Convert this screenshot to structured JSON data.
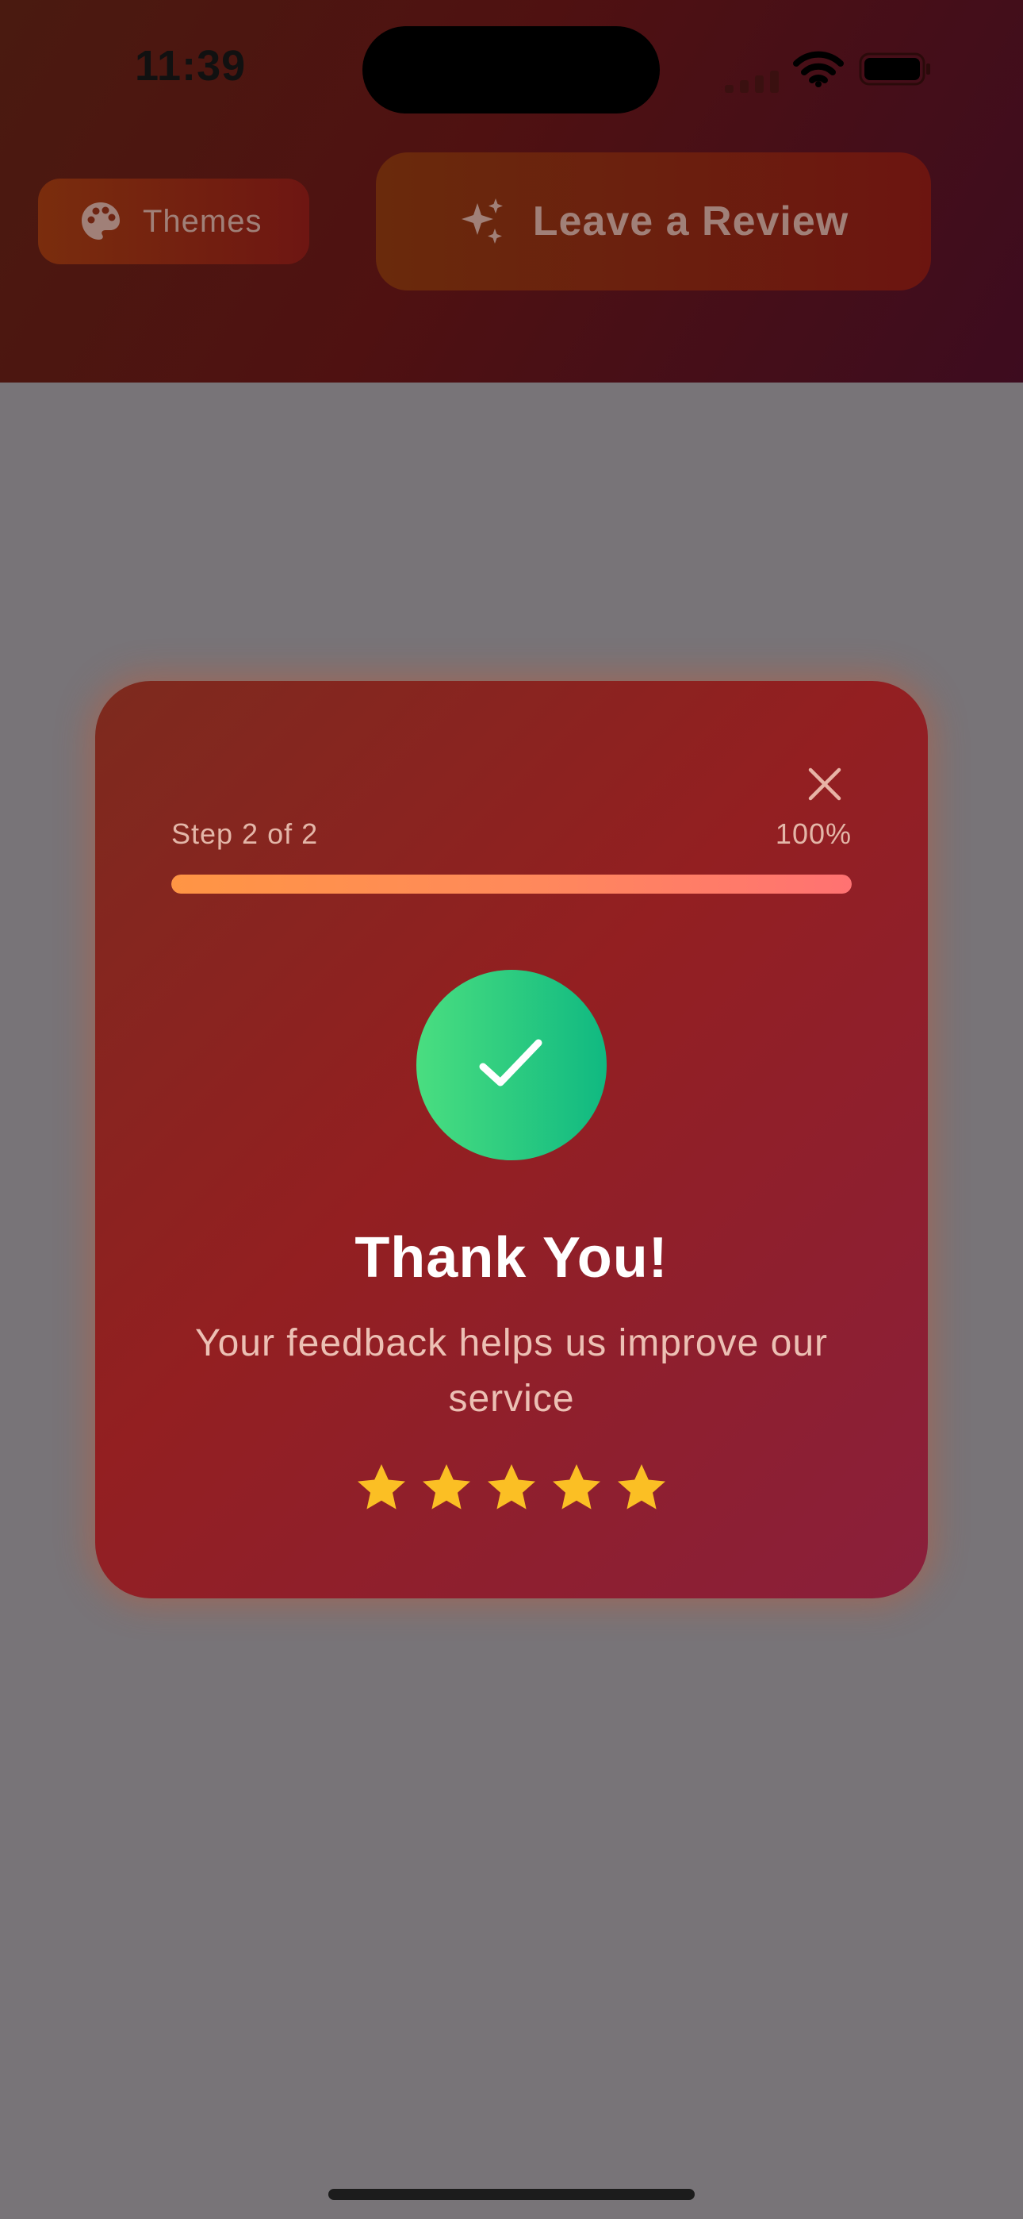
{
  "status_bar": {
    "time": "11:39",
    "icons": [
      "signal-icon",
      "wifi-icon",
      "battery-icon"
    ]
  },
  "header": {
    "themes_button": {
      "label": "Themes",
      "icon": "palette-icon"
    },
    "review_button": {
      "label": "Leave a Review",
      "icon": "sparkles-icon"
    }
  },
  "modal": {
    "step_label": "Step 2 of 2",
    "progress_percent_label": "100%",
    "progress_value": 1.0,
    "success_icon": "checkmark-icon",
    "title": "Thank You!",
    "message": "Your feedback helps us improve our service",
    "rating": 5,
    "rating_max": 5,
    "close_icon": "close-icon"
  },
  "colors": {
    "star": "#fbbf24",
    "success_start": "#4ade80",
    "success_end": "#10b981",
    "progress_start": "#ff9544",
    "progress_end": "#ff7272"
  }
}
